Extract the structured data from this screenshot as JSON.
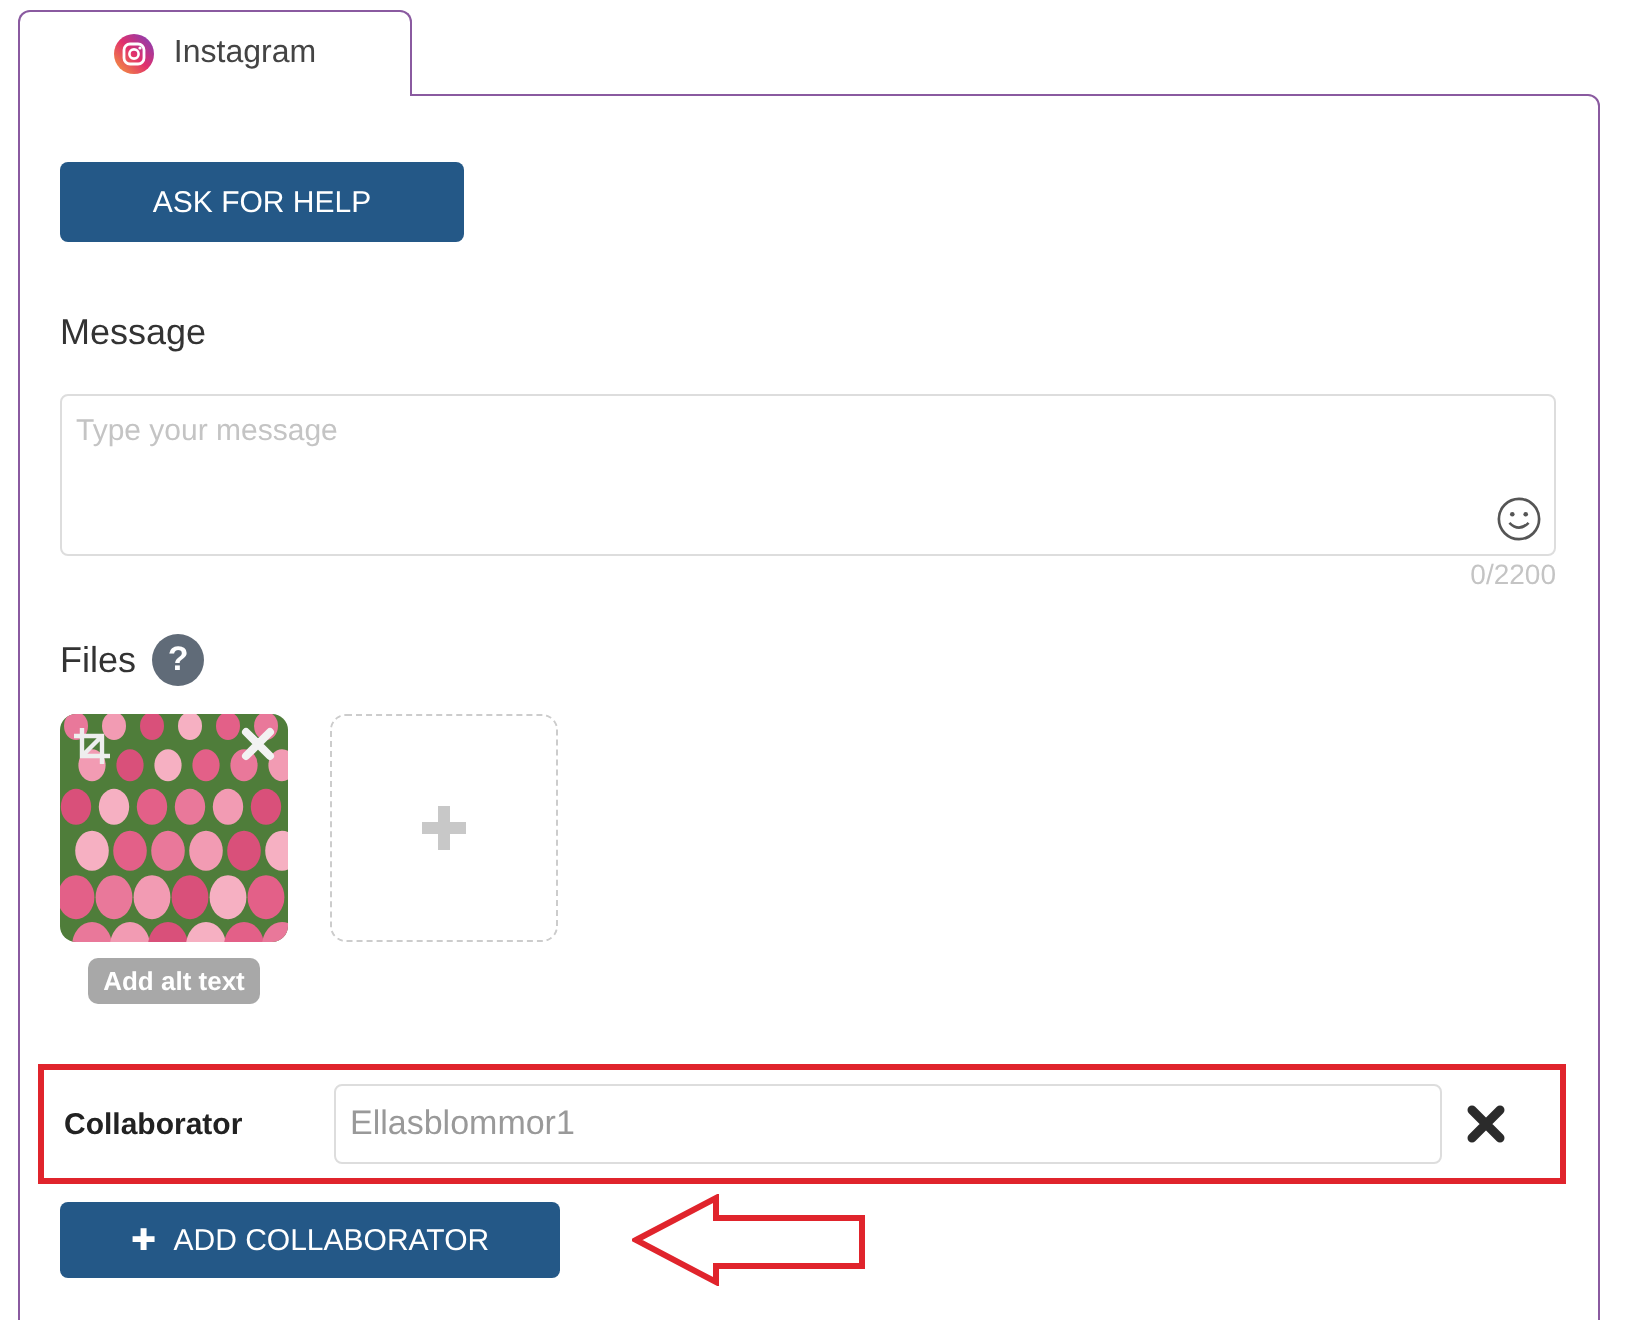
{
  "tabs": [
    {
      "label": "Instagram",
      "selected": true
    }
  ],
  "help_button": "ASK FOR HELP",
  "message": {
    "label": "Message",
    "placeholder": "Type your message",
    "counter": "0/2200"
  },
  "files": {
    "label": "Files",
    "help_icon": "?",
    "items": [
      {
        "kind": "picture",
        "alt_button": "Add alt text"
      }
    ]
  },
  "collaborator": {
    "label": "Collaborator",
    "value": "Ellasblommor1",
    "highlighted": true
  },
  "add_collaborator_button": {
    "icon": "✚",
    "label": "ADD COLLABORATOR"
  },
  "annotation_arrow": true
}
